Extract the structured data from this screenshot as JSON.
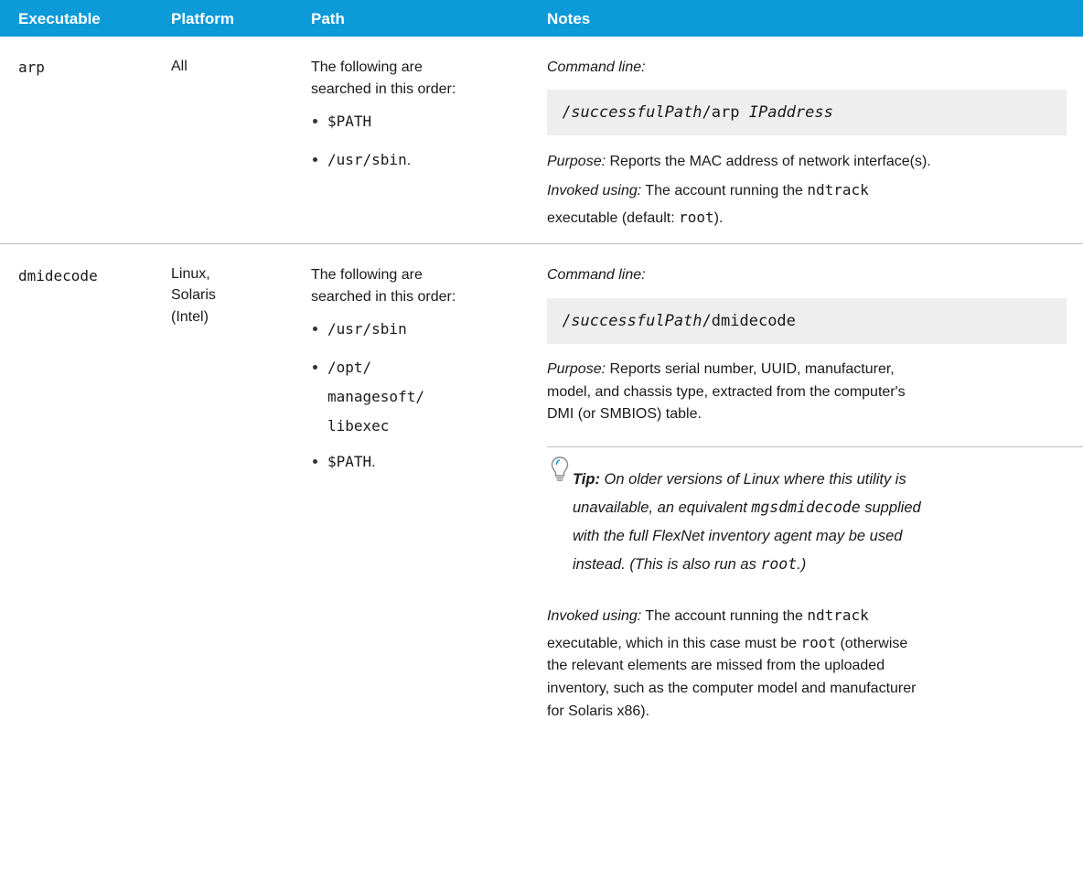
{
  "header": {
    "col1": "Executable",
    "col2": "Platform",
    "col3": "Path",
    "col4": "Notes",
    "bg_color": "#0c9ad9"
  },
  "rows": [
    {
      "executable": "arp",
      "platform": "All",
      "path_intro_1": "The following are",
      "path_intro_2": "searched in this order:",
      "paths": [
        "$PATH",
        "/usr/sbin."
      ],
      "cmd_label": "Command line:",
      "cmd_prefix": "/",
      "cmd_var": "successfulPath",
      "cmd_rest": "/arp ",
      "cmd_arg": "IPaddress",
      "purpose_label": "Purpose:",
      "purpose_lines": [
        "Reports the MAC address of network interface(s)."
      ],
      "invoked_label": "Invoked using:",
      "invoked_a": "The account running the",
      "invoked_code": "ndtrack",
      "invoked_b": "executable (default:",
      "invoked_root": "root",
      "invoked_c": ")."
    },
    {
      "executable": "dmidecode",
      "platform_lines": [
        "Linux,",
        "Solaris",
        "(Intel)"
      ],
      "path_intro_1": "The following are",
      "path_intro_2": "searched in this order:",
      "paths": [
        "/usr/sbin",
        "/opt/",
        "managesoft/",
        "libexec",
        "$PATH."
      ],
      "cmd_label": "Command line:",
      "cmd_prefix": "/",
      "cmd_var": "successfulPath",
      "cmd_rest": "/dmidecode",
      "purpose_label": "Purpose:",
      "purpose_lines": [
        "Reports serial number, UUID, manufacturer,",
        "model, and chassis type, extracted from the computer's",
        "DMI (or SMBIOS) table."
      ],
      "tip_label": "Tip:",
      "tip_1": "On older versions of Linux where this utility is",
      "tip_2a": "unavailable, an equivalent",
      "tip_2code": "mgsdmidecode",
      "tip_2b": "supplied",
      "tip_3": "with the full FlexNet inventory agent may be used",
      "tip_4a": "instead. (This is also run as",
      "tip_4code": "root",
      "tip_4b": ".)",
      "invoked_label": "Invoked using:",
      "invoked_a": "The account running the",
      "invoked_code": "ndtrack",
      "invoked_b": "executable, which in this case must be",
      "invoked_root": "root",
      "invoked_c": "(otherwise",
      "invoked_lines": [
        "the relevant elements are missed from the uploaded",
        "inventory, such as the computer model and manufacturer",
        "for Solaris x86)."
      ]
    }
  ],
  "icons": {
    "tip": "lightbulb-icon"
  }
}
